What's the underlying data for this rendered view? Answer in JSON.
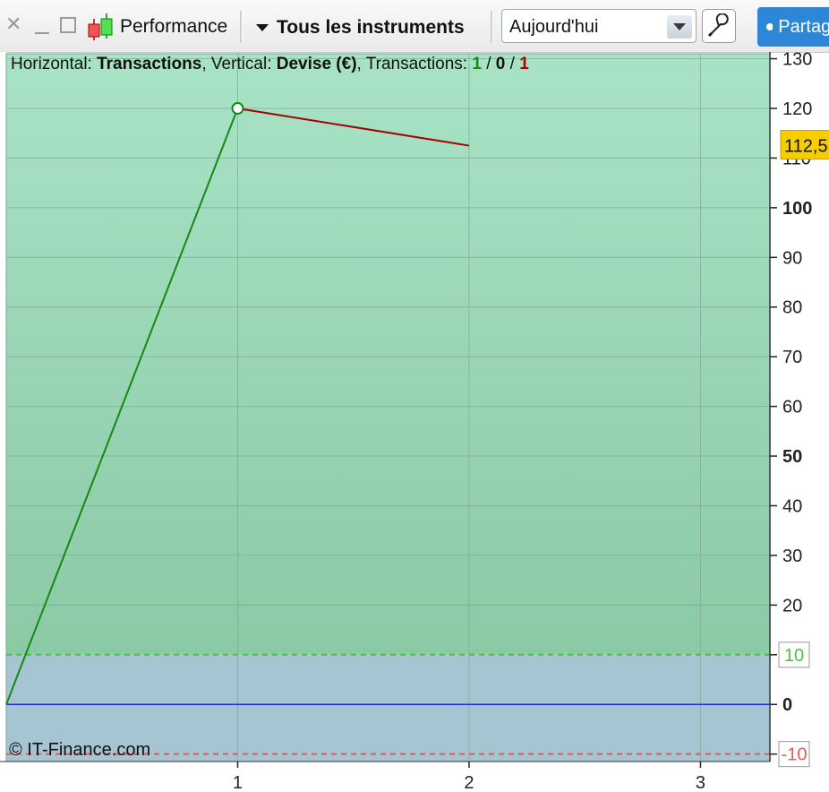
{
  "toolbar": {
    "performance_label": "Performance",
    "instruments_label": "Tous les instruments",
    "period_value": "Aujourd'hui",
    "share_label": "Partager",
    "icons": [
      "close-icon",
      "minimize-icon",
      "maximize-icon",
      "candlestick-icon",
      "dropdown-arrow-icon",
      "wrench-icon",
      "share-icon"
    ]
  },
  "info": {
    "h_prefix": "Horizontal: ",
    "h_value": "Transactions",
    "v_prefix": ", Vertical: ",
    "v_value": "Devise (€)",
    "t_prefix": ", Transactions: ",
    "t_win": "1",
    "sep1": " / ",
    "t_neutral": "0",
    "sep2": " / ",
    "t_loss": "1"
  },
  "copyright": "© IT-Finance.com",
  "colors": {
    "win": "#138a13",
    "loss": "#a80000",
    "zero_line": "#1f2fd6",
    "upper_threshold": "#45c445",
    "lower_threshold": "#e25b5b",
    "last_value_bg": "#f6cd00"
  },
  "chart_data": {
    "type": "line",
    "xlabel": "",
    "ylabel": "",
    "x": [
      0,
      1,
      2
    ],
    "series": [
      {
        "values": [
          0,
          120,
          112.5
        ]
      }
    ],
    "segment_colors": [
      "win",
      "loss"
    ],
    "xlim": [
      0,
      3.3
    ],
    "ylim": [
      -11.5,
      131
    ],
    "x_ticks": [
      "1",
      "2",
      "3"
    ],
    "y_ticks": [
      "-10",
      "0",
      "10",
      "20",
      "30",
      "40",
      "50",
      "60",
      "70",
      "80",
      "90",
      "100",
      "110",
      "120",
      "130"
    ],
    "y_bold_ticks": [
      "0",
      "50",
      "100"
    ],
    "upper_threshold": 10,
    "lower_threshold": -10,
    "last_value_label": "112,5",
    "grid": true
  }
}
